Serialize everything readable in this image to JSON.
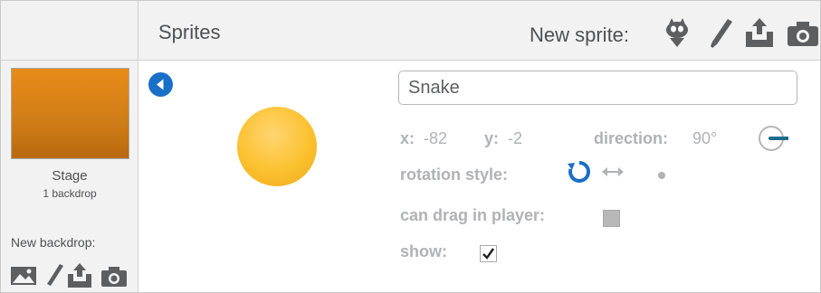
{
  "header": {
    "sprites_title": "Sprites",
    "new_sprite_label": "New sprite:",
    "new_sprite_tools": [
      "sprite-library-icon",
      "paint-brush-icon",
      "upload-icon",
      "camera-icon"
    ]
  },
  "stage": {
    "name": "Stage",
    "backdrop_count": "1 backdrop",
    "thumbnail_color": "#e18618",
    "new_backdrop_label": "New backdrop:",
    "new_backdrop_tools": [
      "image-icon",
      "paint-brush-icon",
      "upload-icon",
      "camera-icon"
    ]
  },
  "sprite": {
    "name": "Snake",
    "x_label": "x:",
    "x_value": "-82",
    "y_label": "y:",
    "y_value": "-2",
    "direction_label": "direction:",
    "direction_value": "90°",
    "rotation_style_label": "rotation style:",
    "rotation_styles": [
      "all-around",
      "left-right",
      "don't-rotate"
    ],
    "rotation_style_selected": "all-around",
    "can_drag_label": "can drag in player:",
    "can_drag_checked": false,
    "show_label": "show:",
    "show_checked": true,
    "costume_color": "#fbc12e",
    "accent_color": "#1a6fc9",
    "dial_color": "#1a6d8a"
  }
}
